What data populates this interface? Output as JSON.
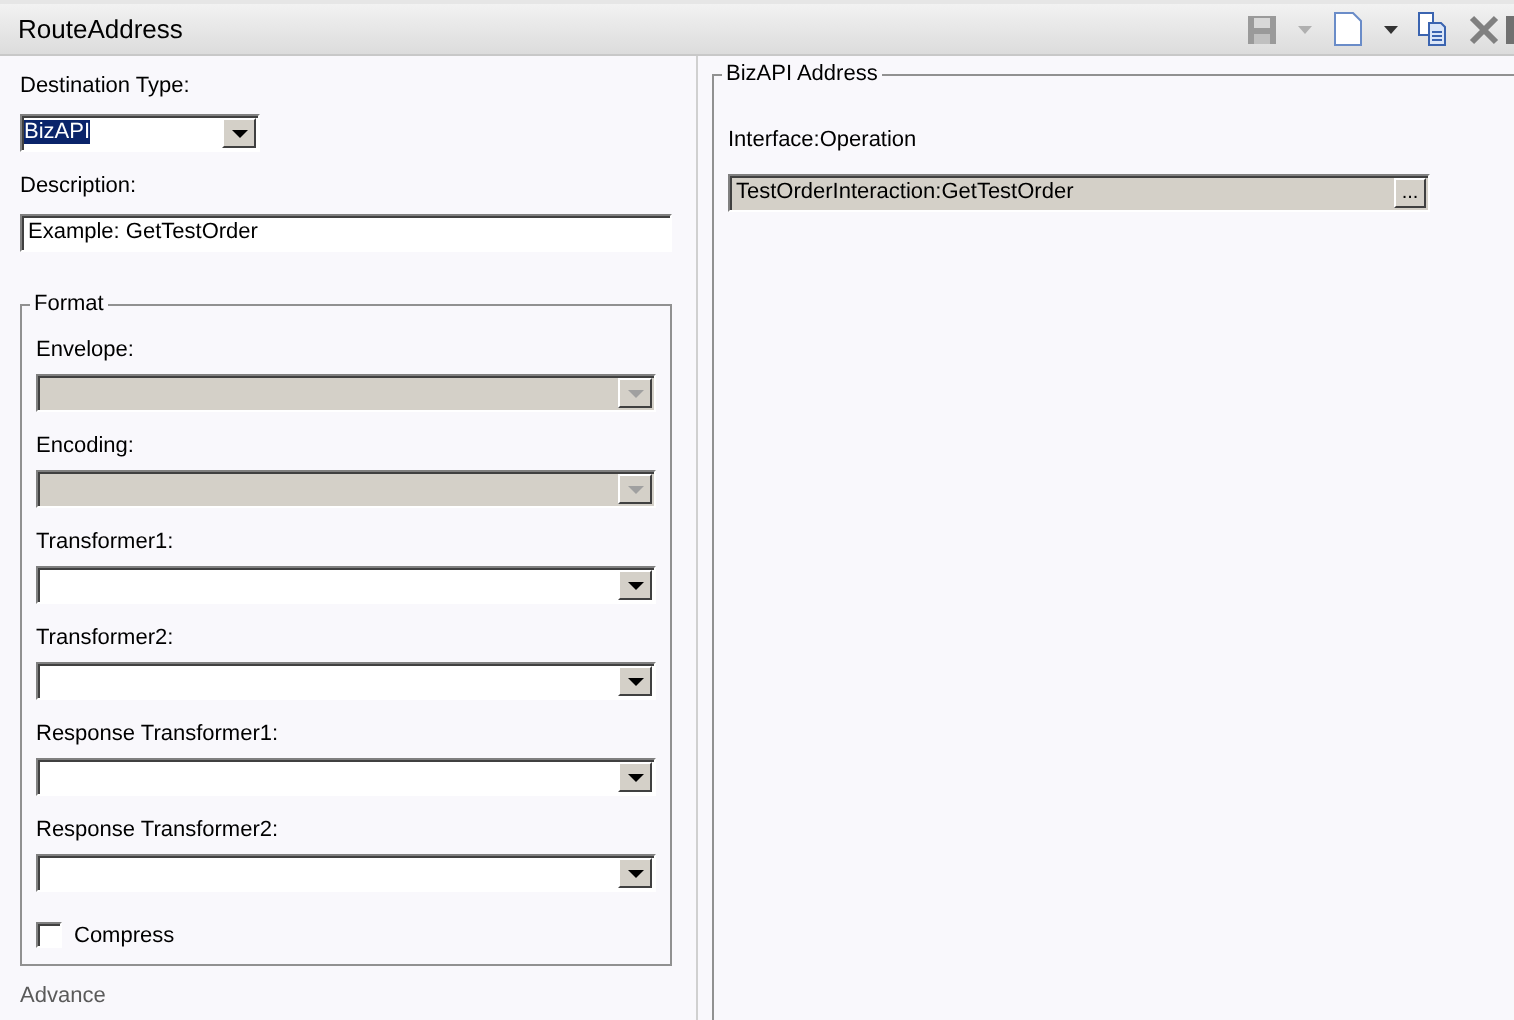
{
  "window": {
    "title": "RouteAddress"
  },
  "toolbar": [
    {
      "kind": "save",
      "disabled": true
    },
    {
      "kind": "dropdown",
      "disabled": true
    },
    {
      "kind": "new",
      "disabled": false
    },
    {
      "kind": "dropdown",
      "disabled": false
    },
    {
      "kind": "copy",
      "disabled": false
    },
    {
      "kind": "delete",
      "disabled": false
    }
  ],
  "destination_type": {
    "label": "Destination Type:",
    "value": "BizAPI",
    "selected": true
  },
  "description": {
    "label": "Description:",
    "value": "Example: GetTestOrder"
  },
  "format": {
    "legend": "Format",
    "fields": [
      {
        "label": "Envelope:",
        "disabled": true
      },
      {
        "label": "Encoding:",
        "disabled": true
      },
      {
        "label": "Transformer1:",
        "disabled": false
      },
      {
        "label": "Transformer2:",
        "disabled": false
      },
      {
        "label": "Response Transformer1:",
        "disabled": false
      },
      {
        "label": "Response Transformer2:",
        "disabled": false
      }
    ],
    "compress": {
      "label": "Compress",
      "checked": false
    }
  },
  "advance": "Advance",
  "bizapi_address": {
    "legend": "BizAPI Address",
    "label": "Interface:Operation",
    "value": "TestOrderInteraction:GetTestOrder",
    "button": "..."
  }
}
